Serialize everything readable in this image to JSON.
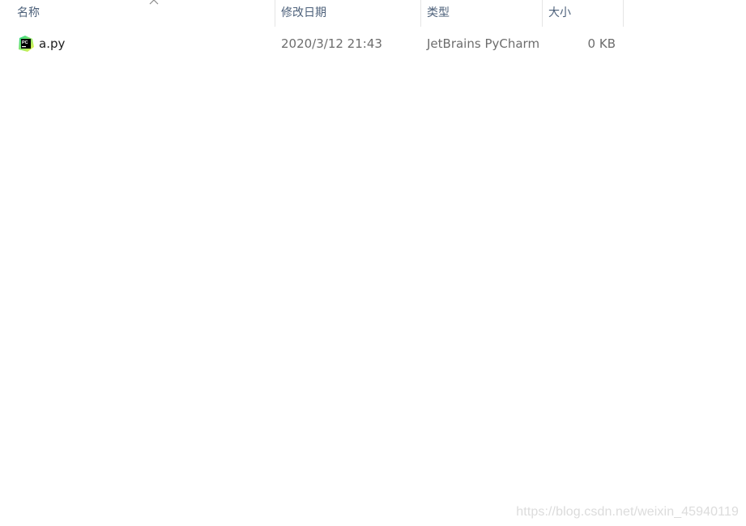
{
  "columns": {
    "name": "名称",
    "date_modified": "修改日期",
    "type": "类型",
    "size": "大小"
  },
  "sort": {
    "column": "name",
    "direction": "ascending",
    "icon": "chevron-up-icon"
  },
  "files": [
    {
      "name": "a.py",
      "date_modified": "2020/3/12 21:43",
      "type": "JetBrains PyCharm",
      "size": "0 KB",
      "icon": "pycharm-file-icon"
    }
  ],
  "watermark": "https://blog.csdn.net/weixin_45940119",
  "colors": {
    "header_text": "#4c607a",
    "name_text": "#1e1e1e",
    "detail_text": "#6d6d6d",
    "column_separator": "#e5e5e5",
    "watermark": "#dcdcdc",
    "icon_green": "#21d789",
    "icon_yellow": "#fcf84a"
  }
}
